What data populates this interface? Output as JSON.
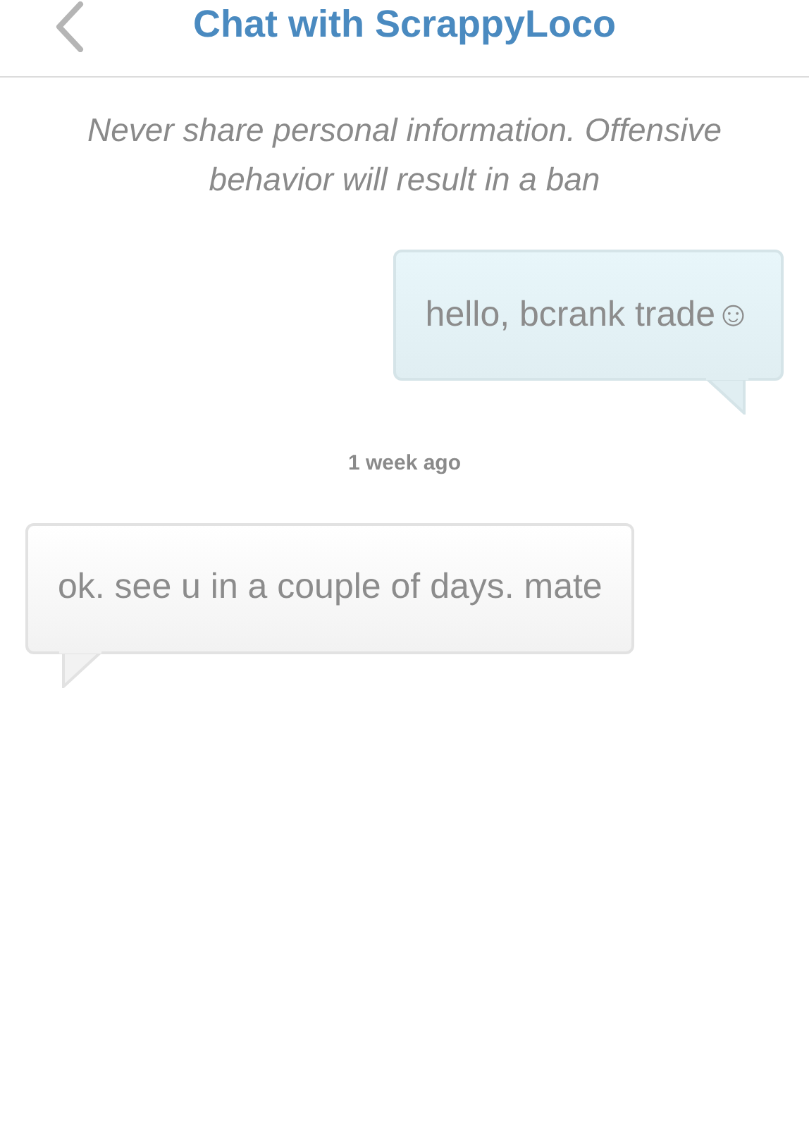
{
  "header": {
    "title": "Chat with ScrappyLoco"
  },
  "notice": "Never share personal information. Offensive behavior will result in a ban",
  "messages": [
    {
      "kind": "outgoing",
      "text": "hello, bcrank trade☺"
    },
    {
      "kind": "timestamp",
      "text": "1 week ago"
    },
    {
      "kind": "incoming",
      "text": "ok. see u in a couple of days. mate"
    }
  ]
}
